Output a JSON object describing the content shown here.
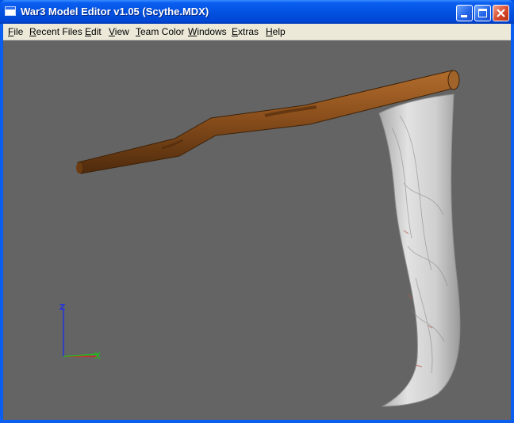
{
  "window": {
    "title": "War3 Model Editor v1.05 (Scythe.MDX)"
  },
  "menu": [
    {
      "mn": "F",
      "rest": "ile"
    },
    {
      "mn": "R",
      "rest": "ecent Files"
    },
    {
      "mn": "E",
      "rest": "dit"
    },
    {
      "mn": "V",
      "rest": "iew"
    },
    {
      "mn": "T",
      "rest": "eam Color"
    },
    {
      "mn": "W",
      "rest": "indows"
    },
    {
      "mn": "E",
      "rest": "xtras"
    },
    {
      "mn": "H",
      "rest": "elp"
    }
  ],
  "axes": {
    "z_label": "Z",
    "z_color": "#2233dd",
    "x_color": "#dd2222",
    "y_color": "#22bb22"
  },
  "colors": {
    "viewport_bg": "#646464",
    "shaft": "#8a4f1c",
    "blade": "#d6d6d6"
  }
}
